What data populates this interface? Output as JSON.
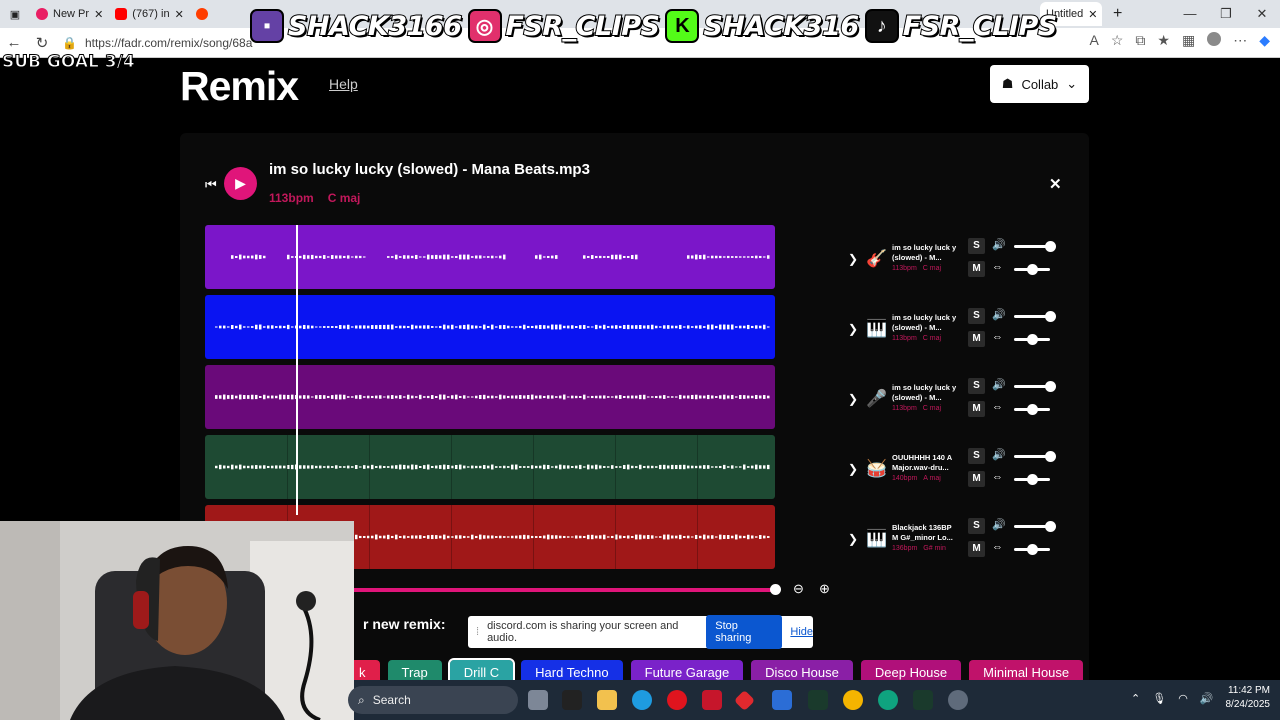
{
  "browser": {
    "tabs": [
      {
        "label": "New Pr",
        "color": "#e91e63"
      },
      {
        "label": "(767) in",
        "color": "#ff0000"
      },
      {
        "label": "",
        "color": "#ff3d00"
      },
      {
        "label": "Untitled",
        "color": "#ff5722"
      }
    ],
    "url": "https://fadr.com/remix/song/68a"
  },
  "stream": {
    "handles": [
      {
        "platform": "twitch",
        "icon_color": "#6441a5",
        "text": "SHACK3166"
      },
      {
        "platform": "instagram",
        "icon_color": "#e1306c",
        "text": "FSR_CLIPS"
      },
      {
        "platform": "kick",
        "icon_color": "#53fc18",
        "text": "SHACK316"
      },
      {
        "platform": "tiktok",
        "icon_color": "#111111",
        "text": "FSR_CLIPS"
      }
    ],
    "sub_goal": "SUB GOAL 3/4"
  },
  "page": {
    "title": "Remix",
    "help": "Help",
    "collab": "Collab",
    "song_title": "im so lucky lucky (slowed) - Mana Beats.mp3",
    "bpm": "113bpm",
    "key": "C maj",
    "remix_heading": "r new remix:",
    "tracks": [
      {
        "name": "im so lucky luck y (slowed) - M...",
        "bpm": "113bpm",
        "key": "C maj",
        "icon": "guitar-icon",
        "glyph": "🎸",
        "color": "#7b16c9",
        "volume": 1.0,
        "pan": 0.5
      },
      {
        "name": "im so lucky luck y (slowed) - M...",
        "bpm": "113bpm",
        "key": "C maj",
        "icon": "piano-icon",
        "glyph": "🎹",
        "color": "#0a14f2",
        "volume": 1.0,
        "pan": 0.5
      },
      {
        "name": "im so lucky luck y (slowed) - M...",
        "bpm": "113bpm",
        "key": "C maj",
        "icon": "microphone-icon",
        "glyph": "🎤",
        "color": "#6a0a7a",
        "volume": 1.0,
        "pan": 0.5
      },
      {
        "name": "OUUHHHH 140 A Major.wav-dru...",
        "bpm": "140bpm",
        "key": "A maj",
        "icon": "drums-icon",
        "glyph": "🥁",
        "color": "#1e4a33",
        "volume": 1.0,
        "pan": 0.5
      },
      {
        "name": "Blackjack 136BP M G#_minor Lo...",
        "bpm": "136bpm",
        "key": "G# min",
        "icon": "piano-icon",
        "glyph": "🎹",
        "color": "#a01818",
        "volume": 1.0,
        "pan": 0.5
      }
    ],
    "genres": [
      {
        "label": "k",
        "color": "#e01f4a"
      },
      {
        "label": "Trap",
        "color": "#1f8a6b"
      },
      {
        "label": "Drill C",
        "color": "#2aa3a3"
      },
      {
        "label": "Hard Techno",
        "color": "#1530e6"
      },
      {
        "label": "Future Garage",
        "color": "#7a22c9"
      },
      {
        "label": "Disco House",
        "color": "#8a1fa6"
      },
      {
        "label": "Deep House",
        "color": "#b0107a"
      },
      {
        "label": "Minimal House",
        "color": "#c0126a"
      }
    ]
  },
  "share_banner": {
    "text": "discord.com is sharing your screen and audio.",
    "stop": "Stop sharing",
    "hide": "Hide"
  },
  "taskbar": {
    "search": "Search",
    "time": "11:42 PM",
    "date": "8/24/2025"
  }
}
